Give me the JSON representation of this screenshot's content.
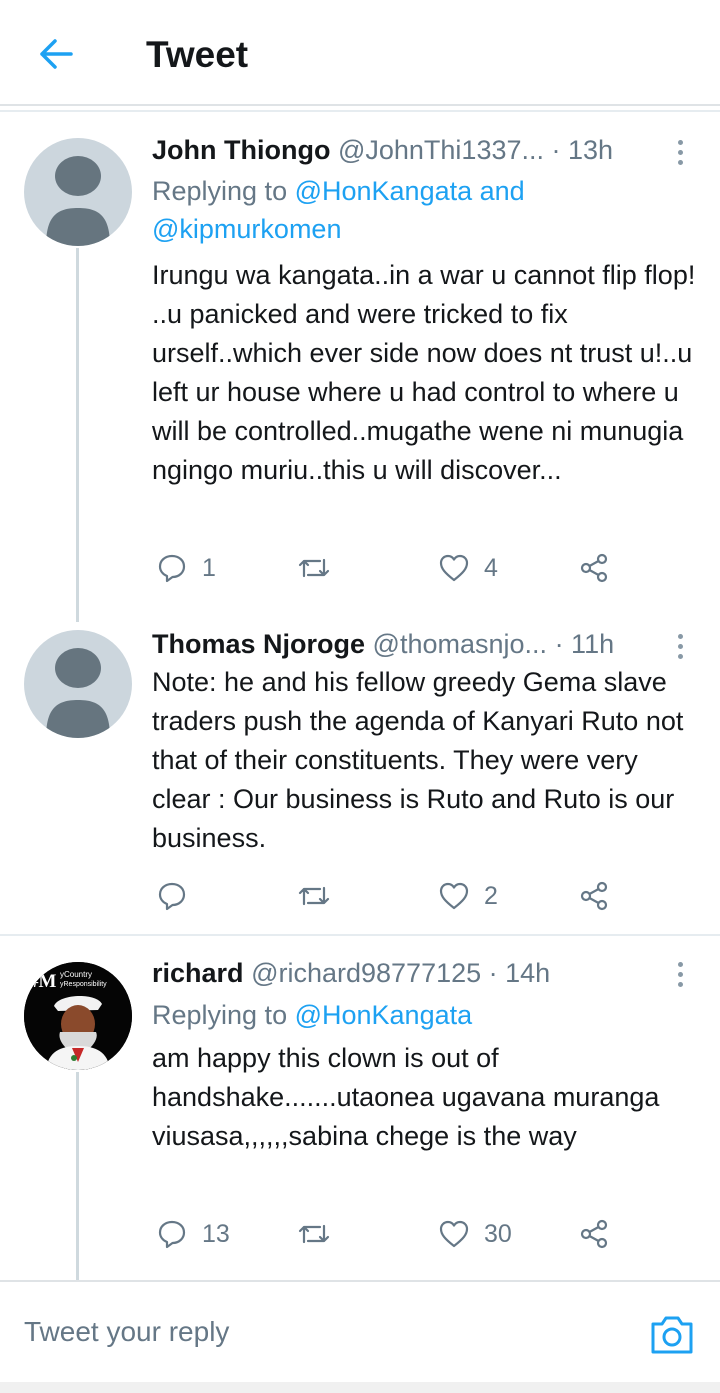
{
  "header": {
    "title": "Tweet"
  },
  "colors": {
    "accent": "#1da1f2",
    "muted": "#657786",
    "text": "#14171a"
  },
  "tweets": [
    {
      "name": "John Thiongo",
      "handle": "@JohnThi1337...",
      "time": "· 13h",
      "replying_prefix": "Replying to ",
      "replying_mentions": "@HonKangata and @kipmurkomen",
      "text": "Irungu wa kangata..in a war u cannot flip flop! ..u panicked and were tricked to fix urself..which ever side now does nt trust u!..u left ur house where u had control to where u will be controlled..mugathe wene ni munugia ngingo muriu..this u will discover...",
      "replies": "1",
      "retweets": "",
      "likes": "4"
    },
    {
      "name": "Thomas Njoroge",
      "handle": "@thomasnjo...",
      "time": "· 11h",
      "text": "Note: he and his fellow greedy Gema slave traders push the agenda of Kanyari Ruto not that of their constituents. They were very clear : Our business is Ruto and Ruto is our business.",
      "replies": "",
      "retweets": "",
      "likes": "2"
    },
    {
      "name": "richard",
      "handle": "@richard98777125",
      "time": "· 14h",
      "replying_prefix": "Replying to ",
      "replying_mentions": "@HonKangata",
      "text": "am happy this clown is out of handshake.......utaonea ugavana muranga viusasa,,,,,,sabina chege is the way",
      "replies": "13",
      "retweets": "",
      "likes": "30",
      "avatar_text": {
        "hash": "#M",
        "line1": "yCountry",
        "line2": "yResponsibility"
      }
    }
  ],
  "compose": {
    "placeholder": "Tweet your reply"
  }
}
